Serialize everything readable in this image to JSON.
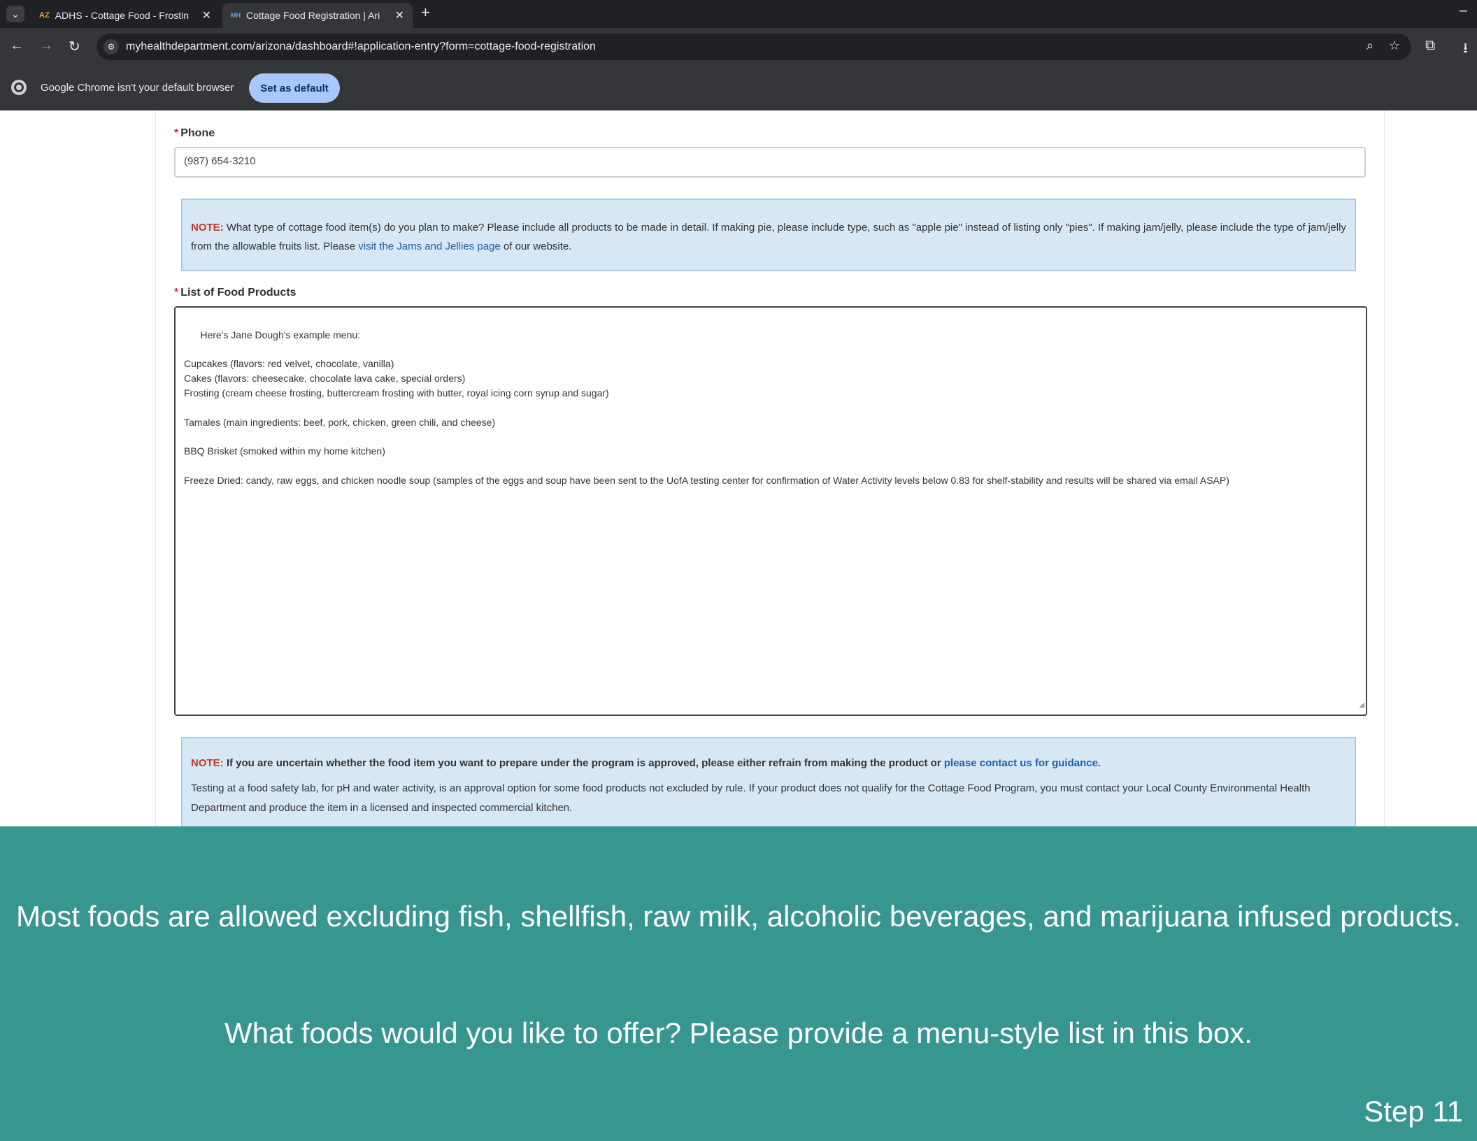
{
  "browser": {
    "tabs": [
      {
        "title": "ADHS - Cottage Food - Frostin",
        "favicon": "AZ",
        "active": false
      },
      {
        "title": "Cottage Food Registration | Ari",
        "favicon": "MH",
        "active": true
      }
    ],
    "url": "myhealthdepartment.com/arizona/dashboard#!application-entry?form=cottage-food-registration",
    "infobar": {
      "message": "Google Chrome isn't your default browser",
      "button": "Set as default"
    },
    "icons": {
      "tab_menu": "⌄",
      "close": "✕",
      "new_tab": "+",
      "minimize": "–",
      "back": "←",
      "forward": "→",
      "reload": "↻",
      "site_info": "⚙",
      "zoom": "⌕",
      "bookmark": "☆",
      "extensions": "⧉",
      "download": "⭳"
    }
  },
  "form": {
    "required_mark": "*",
    "phone_label": "Phone",
    "phone_value": "(987) 654-3210",
    "note1": {
      "label": "NOTE:",
      "text": " What type of cottage food item(s) do you plan to make? Please include all products to be made in detail. If making pie, please include type, such as \"apple pie\" instead of listing only \"pies\". If making jam/jelly, please include the type of jam/jelly from the allowable fruits list. Please ",
      "link": "visit the Jams and Jellies page",
      "tail": " of our website."
    },
    "products_label": "List of Food Products",
    "products_value": "Here's Jane Dough's example menu:\n\nCupcakes (flavors: red velvet, chocolate, vanilla)\nCakes (flavors: cheesecake, chocolate lava cake, special orders)\nFrosting (cream cheese frosting, buttercream frosting with butter, royal icing corn syrup and sugar)\n\nTamales (main ingredients: beef, pork, chicken, green chili, and cheese)\n\nBBQ Brisket (smoked within my home kitchen)\n\nFreeze Dried: candy, raw eggs, and chicken noodle soup (samples of the eggs and soup have been sent to the UofA testing center for confirmation of Water Activity levels below 0.83 for shelf-stability and results will be shared via email ASAP)",
    "note2": {
      "label": "NOTE:",
      "text": " If you are uncertain whether the food item you want to prepare under the program is approved, please either refrain from making the product or ",
      "link": "please contact us for guidance.",
      "paragraph": "Testing at a food safety lab, for pH and water activity, is an approval option for some food products not excluded by rule. If your product does not qualify for the Cottage Food Program, you must contact your Local County Environmental Health Department and produce the item in a licensed and inspected commercial kitchen."
    }
  },
  "banner": {
    "line1": "Most foods are allowed excluding fish, shellfish, raw milk, alcoholic beverages, and marijuana infused products.",
    "line2": "What foods would you like to offer? Please provide a menu-style list in this box.",
    "step": "Step 11",
    "color": "#389690"
  }
}
